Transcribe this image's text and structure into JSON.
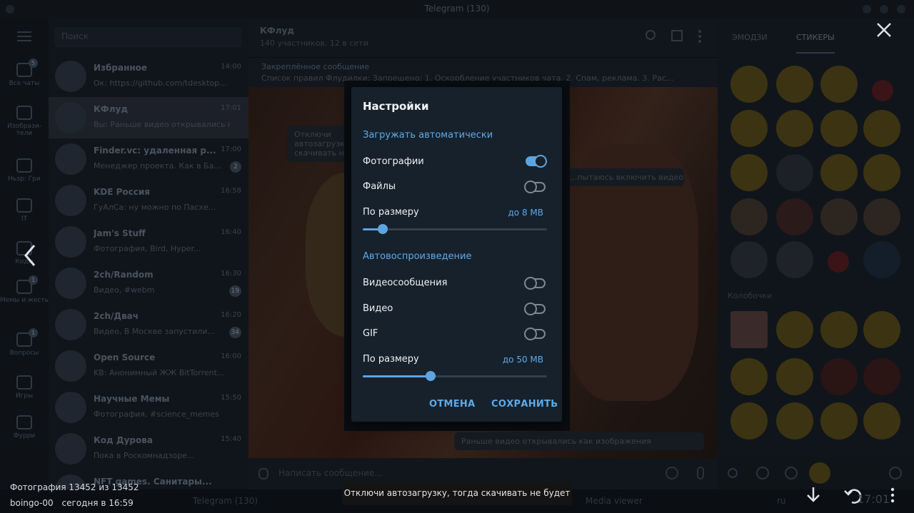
{
  "window": {
    "title": "Telegram (130)"
  },
  "folders": [
    {
      "label": "Все чаты",
      "badge": "5"
    },
    {
      "label": "Изобрази-тели"
    },
    {
      "label": "Ньзр: Гри"
    },
    {
      "label": "IT"
    },
    {
      "label": "Коды"
    },
    {
      "label": "Мемы и жесть",
      "badge": "1"
    },
    {
      "label": "Вопросы",
      "badge": "1"
    },
    {
      "label": "Игры"
    },
    {
      "label": "Фурри"
    }
  ],
  "chatlist": {
    "search_placeholder": "Поиск",
    "chats": [
      {
        "name": "Избранное",
        "message": "Ок: https://github.com/tdesktop...",
        "time": "14:00"
      },
      {
        "name": "КФлуд",
        "message": "Вы: Раньше видео открывались как...",
        "time": "17:01"
      },
      {
        "name": "Finder.vc: удаленная р...",
        "message": "Менеджер проекта. Как в Ба...",
        "time": "17:00",
        "count": "2"
      },
      {
        "name": "KDE Россия",
        "message": "ГуАлСа: ну можно по Пасхе...",
        "time": "16:58"
      },
      {
        "name": "Jam's Stuff",
        "message": "Фотография, Bird, Hyper...",
        "time": "16:40"
      },
      {
        "name": "2ch/Random",
        "message": "Видео, #webm",
        "time": "16:30",
        "count": "19"
      },
      {
        "name": "2ch/Двач",
        "message": "Видео, В Москве запустили...",
        "time": "16:20",
        "count": "34"
      },
      {
        "name": "Open Source",
        "message": "KB: Анонимный ЖЖ BitTorrent...",
        "time": "16:00"
      },
      {
        "name": "Научные Мемы",
        "message": "Фотография, #science_memes",
        "time": "15:50"
      },
      {
        "name": "Код Дурова",
        "message": "Пока в Роскомнадзоре...",
        "time": "15:40"
      },
      {
        "name": "NFT games. Санитары...",
        "message": "",
        "time": "15:30"
      }
    ]
  },
  "chat": {
    "name": "КФлуд",
    "subtitle": "140 участников, 12 в сети",
    "pinned_label": "Закреплённое сообщение",
    "pinned_text": "Список правил Флудилки: Запрещено: 1. Оскорбление участников чата. 2. Спам, реклама. 3. Рас...",
    "composer_placeholder": "Написать сообщение...",
    "bubble1": "Отключи автозагрузку, тогда скачивать не будет",
    "bubble2": "Раньше видео открывались как изображения",
    "bubble3": "...пытаюсь включить видео"
  },
  "stickers_panel": {
    "tab_gif": "ЭМОДЗИ",
    "tab_stickers": "СТИКЕРЫ",
    "set_name": "Колобочки"
  },
  "taskbar": {
    "items": [
      "Telegram (130)",
      "Media viewer"
    ],
    "lang": "ru",
    "time": "17:01"
  },
  "viewer": {
    "photo_counter": "Фотография 13452 из 13452",
    "author": "boingo-00",
    "date": "сегодня в 16:59",
    "caption": "Отключи автозагрузку, тогда скачивать не будет"
  },
  "dialog": {
    "title": "Настройки",
    "autodownload_header": "Загружать автоматически",
    "photos_label": "Фотографии",
    "photos_on": true,
    "files_label": "Файлы",
    "files_on": false,
    "size1_label": "По размеру",
    "size1_value": "до 8 MB",
    "size1_fraction": 0.11,
    "autoplay_header": "Автовоспроизведение",
    "videomsg_label": "Видеосообщения",
    "videomsg_on": false,
    "video_label": "Видео",
    "video_on": false,
    "gif_label": "GIF",
    "gif_on": false,
    "size2_label": "По размеру",
    "size2_value": "до 50 MB",
    "size2_fraction": 0.37,
    "cancel_label": "ОТМЕНА",
    "save_label": "СОХРАНИТЬ"
  },
  "colors": {
    "accent": "#5eaae8",
    "dialog_bg": "#17212b"
  }
}
